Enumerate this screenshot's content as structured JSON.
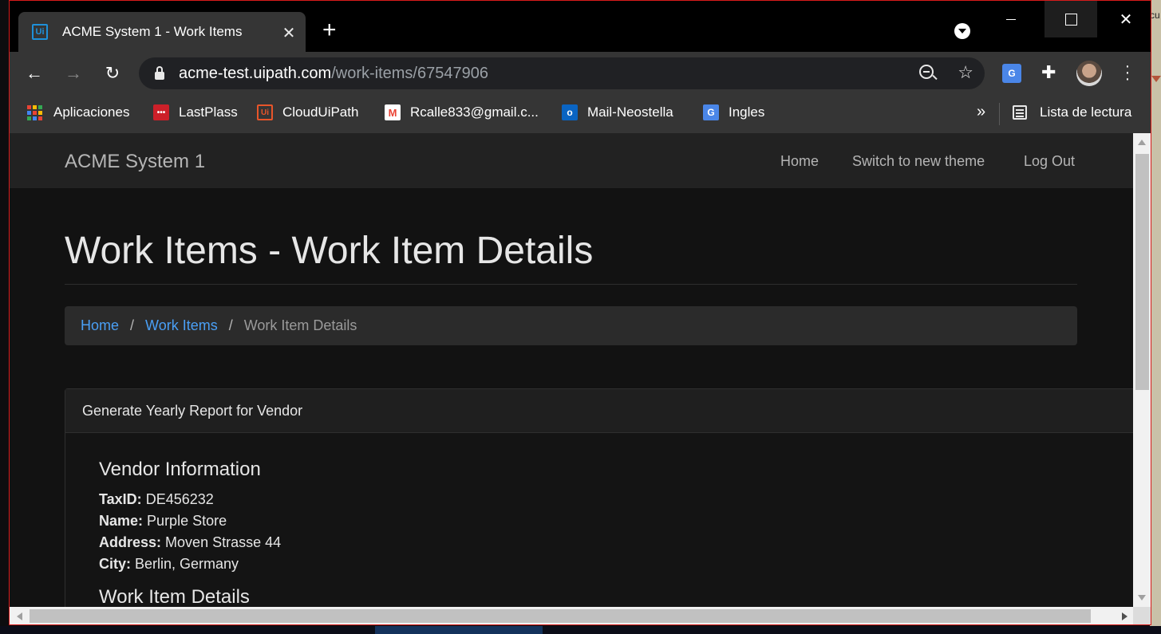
{
  "browser": {
    "tab": {
      "title": "ACME System 1 - Work Items",
      "favicon": "Ui"
    },
    "url": {
      "host": "acme-test.uipath.com",
      "path": "/work-items/67547906"
    },
    "bookmarks": [
      {
        "label": "Aplicaciones",
        "icon": "apps-grid-icon"
      },
      {
        "label": "LastPlass",
        "icon": "lastpass-icon",
        "glyph": "•••"
      },
      {
        "label": "CloudUiPath",
        "icon": "uipath-icon",
        "glyph": "Ui"
      },
      {
        "label": "Rcalle833@gmail.c...",
        "icon": "gmail-icon",
        "glyph": "M"
      },
      {
        "label": "Mail-Neostella",
        "icon": "outlook-icon",
        "glyph": "o"
      },
      {
        "label": "Ingles",
        "icon": "google-translate-icon",
        "glyph": "G"
      }
    ],
    "bookmarks_more": "»",
    "reading_list": "Lista de lectura"
  },
  "site": {
    "brand": "ACME System 1",
    "nav": {
      "home": "Home",
      "switch_theme": "Switch to new theme",
      "logout": "Log Out"
    },
    "page_title": "Work Items - Work Item Details",
    "breadcrumb": {
      "home": "Home",
      "sep": "/",
      "work_items": "Work Items",
      "current": "Work Item Details"
    },
    "card": {
      "header": "Generate Yearly Report for Vendor",
      "vendor_title": "Vendor Information",
      "fields": [
        {
          "label": "TaxID:",
          "value": "DE456232"
        },
        {
          "label": "Name:",
          "value": "Purple Store"
        },
        {
          "label": "Address:",
          "value": "Moven Strasse 44"
        },
        {
          "label": "City:",
          "value": "Berlin, Germany"
        }
      ],
      "details_title": "Work Item Details"
    }
  },
  "desktop": {
    "edge_text": "cu"
  },
  "colors": {
    "link": "#4a9ff5",
    "window_border": "#d81b1b",
    "page_bg": "#121212"
  }
}
